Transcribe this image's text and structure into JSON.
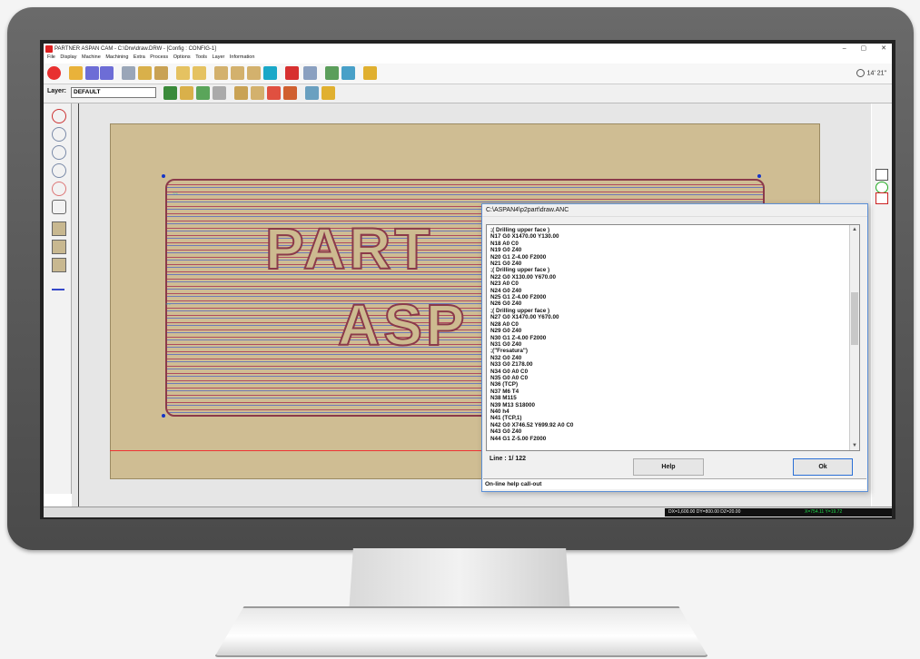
{
  "window": {
    "title": "PARTNER ASPAN CAM - C:\\Drw\\draw.DRW - [Config : CONFIG-1]",
    "controls": [
      "–",
      "▢",
      "✕"
    ]
  },
  "menu": [
    "File",
    "Display",
    "Machine",
    "Machining",
    "Extra",
    "Process",
    "Options",
    "Tools",
    "Layer",
    "Information"
  ],
  "clock": "14' 21\"",
  "layer": {
    "label": "Layer:",
    "value": "DEFAULT"
  },
  "drawing": {
    "text_line1": "PART",
    "text_line2": "ASP"
  },
  "status": {
    "coords": "DX=1,600.00 DY=800.00 DZ=20.00",
    "xy": "X=754.11    Y=19.72"
  },
  "dialog": {
    "title": "C:\\ASPAN4\\p2part\\draw.ANC",
    "lines": [
      ";( Drilling upper face )",
      "N17 G0 X1470.00 Y130.00",
      "N18 A0 C0",
      "N19 G0 Z40",
      "N20 G1 Z-4.00 F2000",
      "N21 G0 Z40",
      ";( Drilling upper face )",
      "N22 G0 X130.00 Y670.00",
      "N23 A0 C0",
      "N24 G0 Z40",
      "N25 G1 Z-4.00 F2000",
      "N26 G0 Z40",
      ";( Drilling upper face )",
      "N27 G0 X1470.00 Y670.00",
      "N28 A0 C0",
      "N29 G0 Z40",
      "N30 G1 Z-4.00 F2000",
      "N31 G0 Z40",
      ";(\"Fresatura\")",
      "N32 G0 Z40",
      "N33 G0 Z178.00",
      "N34 G0 A0 C0",
      "N35 G0 A0 C0",
      "N36 (TCP)",
      "N37 M6 T4",
      "N38 M115",
      "N39 M13 S18000",
      "N40 h4",
      "N41 (TCP,1)",
      "N42 G0 X746.52 Y699.92 A0 C0",
      "N43 G0 Z40",
      "N44 G1 Z-5.00 F2000"
    ],
    "line_label": "Line :    1/  122",
    "help_button": "Help",
    "ok_button": "Ok",
    "help_bar": "On-line help call-out"
  },
  "colors": {
    "panel": "#cfbd93",
    "outline": "#8b3a4a",
    "hatch_blue": "#6f7ab8",
    "accent_blue": "#2a6fd6"
  }
}
